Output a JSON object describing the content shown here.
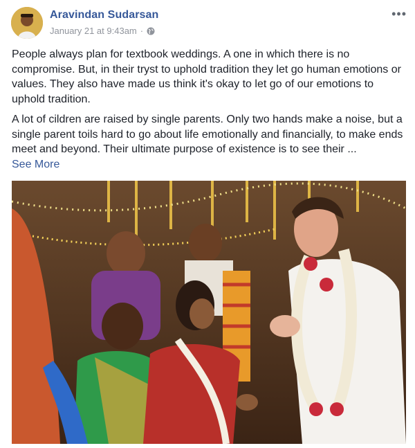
{
  "post": {
    "author": "Aravindan Sudarsan",
    "timestamp": "January 21 at 9:43am",
    "privacy_separator": "·",
    "privacy_icon": "globe-icon",
    "more_icon": "more-options-icon",
    "paragraphs": [
      "People always plan for textbook weddings. A one in which there is no compromise. But, in their tryst to uphold tradition they let go human emotions or values. They also have made us think it's okay to let go of our emotions to uphold tradition.",
      "A lot of cildren are raised by single parents. Only two hands make a noise, but a single parent toils hard to go about life emotionally and financially, to make ends meet and beyond. Their ultimate purpose of existence is to see their ..."
    ],
    "see_more": "See More"
  },
  "colors": {
    "link": "#365899",
    "text": "#1d2129",
    "meta": "#90949c"
  }
}
